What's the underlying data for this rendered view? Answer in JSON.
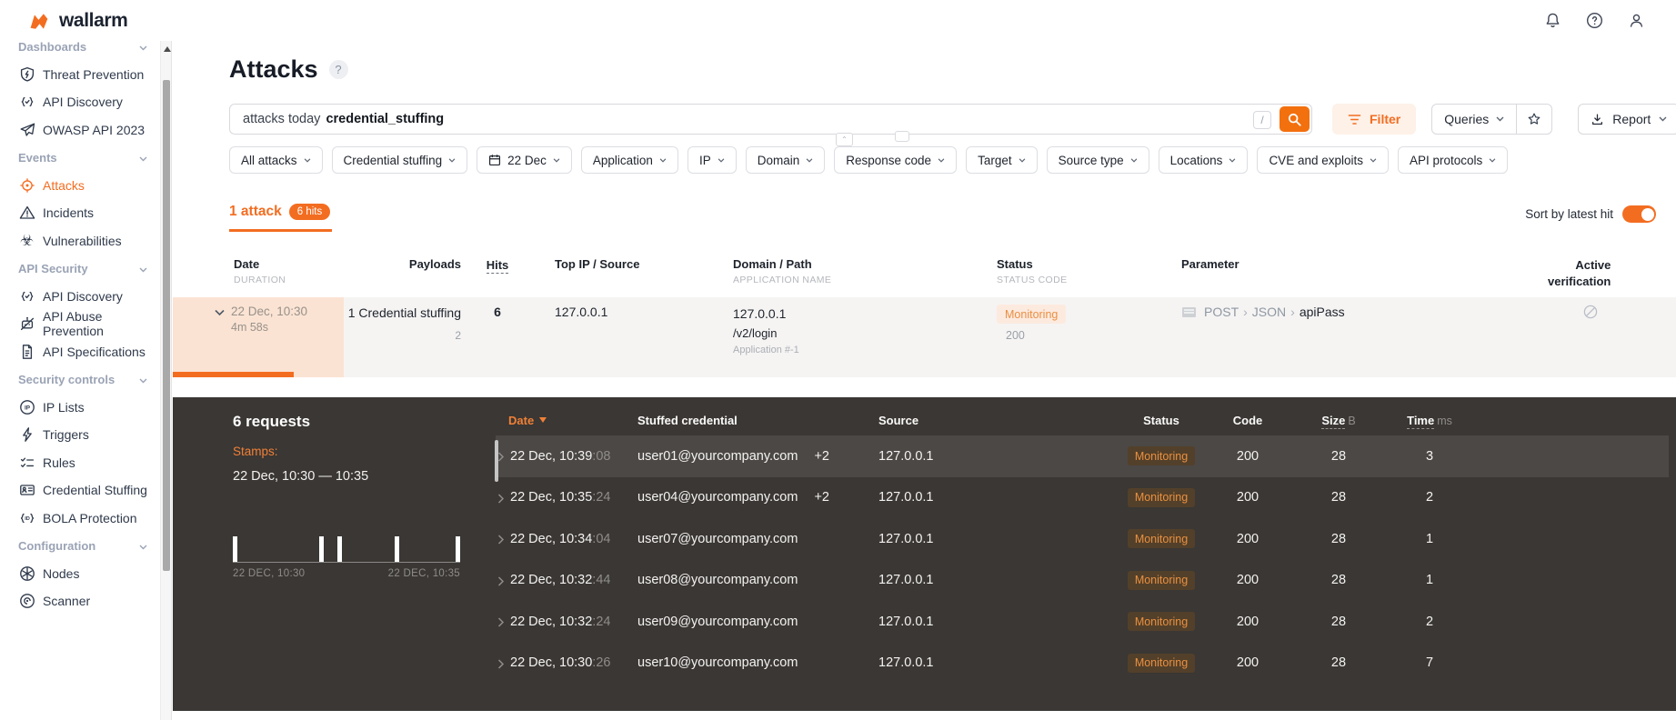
{
  "colors": {
    "accent": "#f36d21",
    "search_button": "#f3700f",
    "dark_panel_bg": "#3a3734",
    "monitoring_light_bg": "#fdeadf",
    "monitoring_dark_bg": "#53402a",
    "monitoring_text": "#e98f42",
    "row_highlight_dark": "#4b4845",
    "attack_row_bg": "#f5f4f3",
    "date_cell_bg": "#fbe3d3"
  },
  "topbar": {
    "logo_text": "wallarm"
  },
  "sidebar": {
    "sections": [
      {
        "label": "Dashboards",
        "items": [
          {
            "label": "Threat Prevention",
            "icon": "shield"
          },
          {
            "label": "API Discovery",
            "icon": "braces-check"
          },
          {
            "label": "OWASP API 2023",
            "icon": "paper-plane"
          }
        ]
      },
      {
        "label": "Events",
        "items": [
          {
            "label": "Attacks",
            "icon": "target",
            "active": true
          },
          {
            "label": "Incidents",
            "icon": "alert-triangle"
          },
          {
            "label": "Vulnerabilities",
            "icon": "biohazard"
          }
        ]
      },
      {
        "label": "API Security",
        "items": [
          {
            "label": "API Discovery",
            "icon": "braces-check"
          },
          {
            "label": "API Abuse Prevention",
            "icon": "bot-blocked"
          },
          {
            "label": "API Specifications",
            "icon": "document"
          }
        ]
      },
      {
        "label": "Security controls",
        "items": [
          {
            "label": "IP Lists",
            "icon": "ip-circle"
          },
          {
            "label": "Triggers",
            "icon": "bolt"
          },
          {
            "label": "Rules",
            "icon": "checklist"
          },
          {
            "label": "Credential Stuffing",
            "icon": "credential-card"
          },
          {
            "label": "BOLA Protection",
            "icon": "id-braces"
          }
        ]
      },
      {
        "label": "Configuration",
        "items": [
          {
            "label": "Nodes",
            "icon": "nodes"
          },
          {
            "label": "Scanner",
            "icon": "scanner"
          }
        ]
      }
    ]
  },
  "page": {
    "title": "Attacks"
  },
  "search": {
    "text": "attacks today",
    "token": "credential_stuffing",
    "shortcut": "/"
  },
  "toolbar": {
    "filter_label": "Filter",
    "queries_label": "Queries",
    "report_label": "Report"
  },
  "filter_chips": [
    {
      "label": "All attacks"
    },
    {
      "label": "Credential stuffing"
    },
    {
      "label": "22 Dec",
      "icon": "calendar"
    },
    {
      "label": "Application"
    },
    {
      "label": "IP"
    },
    {
      "label": "Domain"
    },
    {
      "label": "Response code"
    },
    {
      "label": "Target"
    },
    {
      "label": "Source type"
    },
    {
      "label": "Locations"
    },
    {
      "label": "CVE and exploits"
    },
    {
      "label": "API protocols"
    }
  ],
  "results_bar": {
    "attack_tab": "1 attack",
    "hits_badge": "6 hits",
    "sort_label": "Sort by latest hit",
    "sort_enabled": true
  },
  "attacks_table": {
    "headers": {
      "date": "Date",
      "date_sub": "DURATION",
      "payloads": "Payloads",
      "hits": "Hits",
      "top_ip": "Top IP / Source",
      "domain": "Domain / Path",
      "domain_sub": "APPLICATION NAME",
      "status": "Status",
      "status_sub": "STATUS CODE",
      "parameter": "Parameter",
      "active_verification_1": "Active",
      "active_verification_2": "verification"
    },
    "row": {
      "date": "22 Dec, 10:30",
      "duration": "4m 58s",
      "payloads": "1 Credential stuffing",
      "payloads_sub": "2",
      "hits": "6",
      "top_ip": "127.0.0.1",
      "domain": "127.0.0.1",
      "path": "/v2/login",
      "application": "Application #-1",
      "status": "Monitoring",
      "status_code": "200",
      "param_method": "POST",
      "param_sep1": "›",
      "param_format": "JSON",
      "param_sep2": "›",
      "param_name": "apiPass"
    }
  },
  "details_panel": {
    "title": "6 requests",
    "stamps_label": "Stamps:",
    "range": "22 Dec, 10:30 — 10:35",
    "chart": {
      "type": "event-ticks",
      "x_start_label": "22 DEC, 10:30",
      "x_end_label": "22 DEC, 10:35",
      "bar_positions_pct": [
        0,
        38,
        46,
        71,
        98
      ]
    },
    "table": {
      "headers": {
        "date": "Date",
        "credential": "Stuffed credential",
        "source": "Source",
        "status": "Status",
        "code": "Code",
        "size": "Size",
        "size_unit": "B",
        "time": "Time",
        "time_unit": "ms"
      },
      "rows": [
        {
          "date": "22 Dec, 10:39",
          "seconds": ":08",
          "credential": "user01@yourcompany.com",
          "extra": "+2",
          "source": "127.0.0.1",
          "status": "Monitoring",
          "code": "200",
          "size": "28",
          "time": "3"
        },
        {
          "date": "22 Dec, 10:35",
          "seconds": ":24",
          "credential": "user04@yourcompany.com",
          "extra": "+2",
          "source": "127.0.0.1",
          "status": "Monitoring",
          "code": "200",
          "size": "28",
          "time": "2"
        },
        {
          "date": "22 Dec, 10:34",
          "seconds": ":04",
          "credential": "user07@yourcompany.com",
          "extra": "",
          "source": "127.0.0.1",
          "status": "Monitoring",
          "code": "200",
          "size": "28",
          "time": "1"
        },
        {
          "date": "22 Dec, 10:32",
          "seconds": ":44",
          "credential": "user08@yourcompany.com",
          "extra": "",
          "source": "127.0.0.1",
          "status": "Monitoring",
          "code": "200",
          "size": "28",
          "time": "1"
        },
        {
          "date": "22 Dec, 10:32",
          "seconds": ":24",
          "credential": "user09@yourcompany.com",
          "extra": "",
          "source": "127.0.0.1",
          "status": "Monitoring",
          "code": "200",
          "size": "28",
          "time": "2"
        },
        {
          "date": "22 Dec, 10:30",
          "seconds": ":26",
          "credential": "user10@yourcompany.com",
          "extra": "",
          "source": "127.0.0.1",
          "status": "Monitoring",
          "code": "200",
          "size": "28",
          "time": "7"
        }
      ]
    }
  }
}
